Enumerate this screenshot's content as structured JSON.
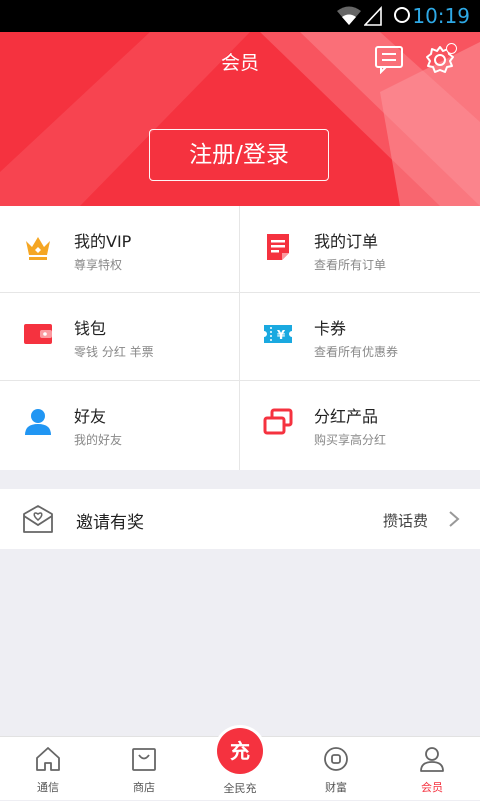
{
  "status_bar": {
    "time": "10:19"
  },
  "header": {
    "title": "会员",
    "login_label": "注册/登录"
  },
  "grid": [
    {
      "name": "我的VIP",
      "sub": "尊享特权",
      "icon": "crown-icon"
    },
    {
      "name": "我的订单",
      "sub": "查看所有订单",
      "icon": "order-icon"
    },
    {
      "name": "钱包",
      "sub": "零钱 分红 羊票",
      "icon": "wallet-icon"
    },
    {
      "name": "卡券",
      "sub": "查看所有优惠券",
      "icon": "coupon-icon"
    },
    {
      "name": "好友",
      "sub": "我的好友",
      "icon": "friend-icon"
    },
    {
      "name": "分红产品",
      "sub": "购买享高分红",
      "icon": "dividend-icon"
    }
  ],
  "invite": {
    "label": "邀请有奖",
    "right": "攒话费"
  },
  "tabs": [
    {
      "label": "通信",
      "icon": "home-icon"
    },
    {
      "label": "商店",
      "icon": "shop-bag-icon"
    },
    {
      "label": "全民充",
      "icon": "charge-icon",
      "glyph": "充"
    },
    {
      "label": "财富",
      "icon": "wealth-icon"
    },
    {
      "label": "会员",
      "icon": "user-icon"
    }
  ],
  "colors": {
    "brand": "#f5323f",
    "crown": "#f5a623",
    "friend": "#2196f3",
    "coupon": "#1aa9e0"
  }
}
